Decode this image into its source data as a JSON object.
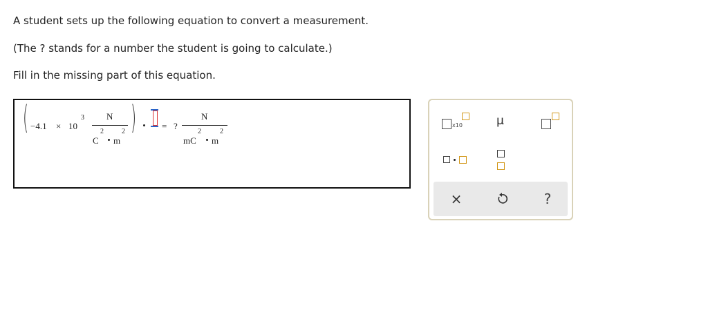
{
  "prompt": {
    "line1": "A student sets up the following equation to convert a measurement.",
    "line2": "(The ? stands for a number the student is going to calculate.)",
    "line3": "Fill in the missing part of this equation."
  },
  "equation": {
    "coefficient": "−4.1",
    "times": "×",
    "base": "10",
    "exponent": "3",
    "lhs_numerator": "N",
    "lhs_den_unit1": "C",
    "lhs_den_exp1": "2",
    "lhs_den_unit2": "m",
    "lhs_den_exp2": "2",
    "equals": "=",
    "unknown": "?",
    "rhs_numerator": "N",
    "rhs_den_unit1": "mC",
    "rhs_den_exp1": "2",
    "rhs_den_unit2": "m",
    "rhs_den_exp2": "2"
  },
  "palette": {
    "sci_notation_label": "x10",
    "mu_symbol": "μ",
    "clear_symbol": "×",
    "help_symbol": "?",
    "colors": {
      "accent": "#d49a1e",
      "action_bg": "#e9e9e9",
      "border": "#d9d2b8"
    }
  }
}
